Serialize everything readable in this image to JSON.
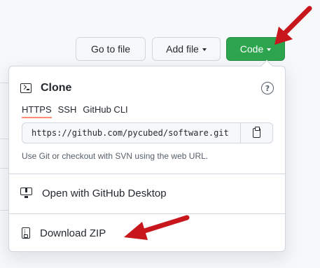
{
  "toolbar": {
    "goto_file_label": "Go to file",
    "add_file_label": "Add file",
    "code_label": "Code"
  },
  "clone": {
    "title": "Clone",
    "help_glyph": "?",
    "tabs": [
      {
        "label": "HTTPS",
        "active": true
      },
      {
        "label": "SSH",
        "active": false
      },
      {
        "label": "GitHub CLI",
        "active": false
      }
    ],
    "url_value": "https://github.com/pycubed/software.git",
    "hint": "Use Git or checkout with SVN using the web URL."
  },
  "actions": {
    "open_desktop_label": "Open with GitHub Desktop",
    "download_zip_label": "Download ZIP"
  },
  "colors": {
    "code_button": "#2da44e",
    "annotation_arrow": "#c8161d",
    "active_tab_underline": "#fd8c73"
  },
  "icons": {
    "clone": "terminal-icon",
    "help": "question-icon",
    "copy": "clipboard-icon",
    "desktop": "desktop-download-icon",
    "zip": "file-zip-icon"
  }
}
